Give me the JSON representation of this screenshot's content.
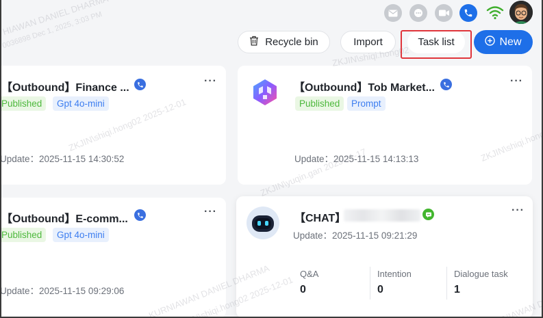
{
  "header": {
    "icons": [
      "mail-icon",
      "message-icon",
      "video-icon",
      "phone-icon",
      "wifi-icon",
      "avatar"
    ]
  },
  "actions": {
    "recycle_label": "Recycle bin",
    "import_label": "Import",
    "task_label": "Task list",
    "new_label": "New"
  },
  "cards": [
    {
      "title": "【Outbound】Finance ...",
      "tags": [
        "Published",
        "Gpt 4o-mini"
      ],
      "update": "Update：2025-11-15 14:30:52",
      "more": "···"
    },
    {
      "title": "【Outbound】Tob Market...",
      "tags": [
        "Published",
        "Prompt"
      ],
      "update": "Update：2025-11-15 14:13:13",
      "more": "···"
    },
    {
      "title": "【Outbound】E-comm...",
      "tags": [
        "Published",
        "Gpt 4o-mini"
      ],
      "update": "Update：2025-11-15 09:29:06",
      "more": "···"
    },
    {
      "title": "【CHAT】",
      "update": "Update：2025-11-15 09:21:29",
      "more": "···",
      "stats": [
        {
          "label": "Q&A",
          "value": "0"
        },
        {
          "label": "Intention",
          "value": "0"
        },
        {
          "label": "Dialogue task",
          "value": "1"
        }
      ]
    }
  ],
  "watermarks": [
    "HIAWAN DANIEL DHARMA",
    "0036898 Dec 1, 2025, 3:03 PM",
    "ZKJIN\\shiqi.hong02 2025-12-01",
    "ZKJIN\\yuqin.gan 2025-11-17",
    "ZKJIN\\shiqi.hong02 2025-12-01",
    "KURNIAWAN DANIEL DHARMA",
    "ZKJIN\\shiqi.hong02 2025-12-01",
    "ZKJIN\\shiqi.hong02",
    "KURNIAWAN DANIEL DHARMA"
  ],
  "colors": {
    "accent": "#1e6fe8",
    "published": "#4db83c",
    "model_tag": "#3d7ef0",
    "highlight_border": "#e0343a"
  }
}
